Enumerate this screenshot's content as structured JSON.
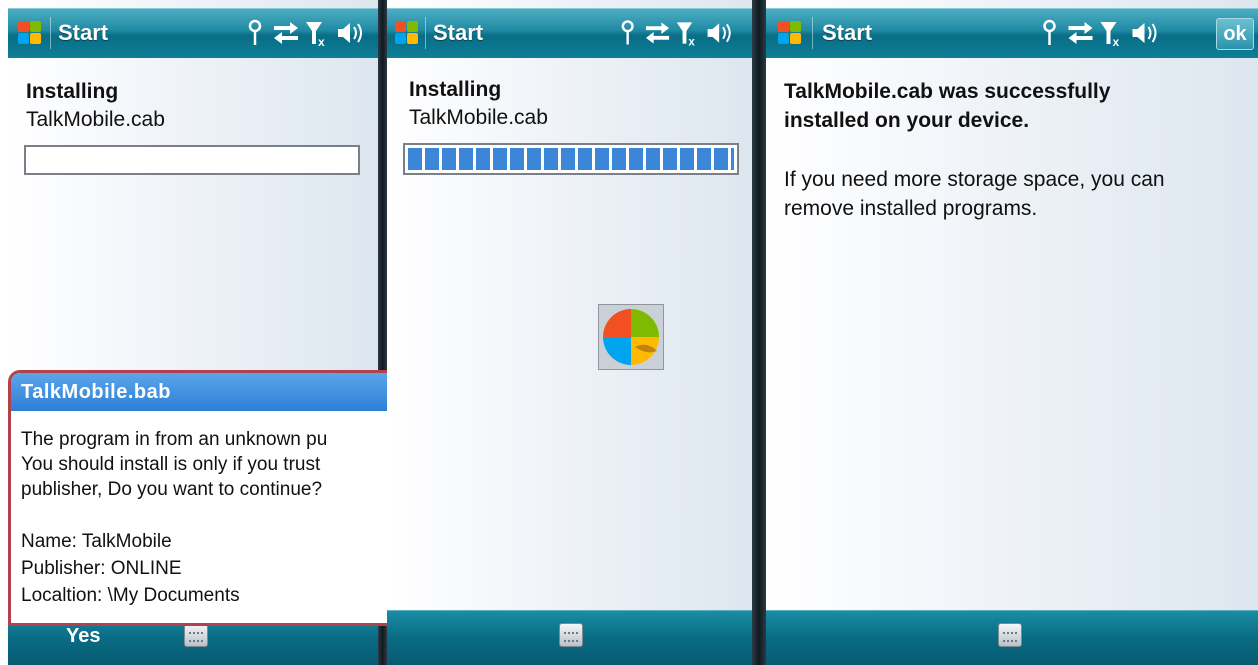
{
  "statusbar": {
    "start_label": "Start",
    "ok_label": "ok"
  },
  "screen1": {
    "heading": "Installing",
    "filename": "TalkMobile.cab",
    "progress": 0,
    "dialog": {
      "title": "TalkMobile.bab",
      "lines": [
        "The program in from an unknown pu",
        "You should install is only if you trust",
        "publisher, Do you want to continue?"
      ],
      "name": "Name: TalkMobile",
      "publisher": "Publisher: ONLINE",
      "location": "Localtion: \\My Documents"
    },
    "softkey_left": "Yes"
  },
  "screen2": {
    "heading": "Installing",
    "filename": "TalkMobile.cab",
    "progress": 1.0
  },
  "screen3": {
    "title_lines": [
      "TalkMobile.cab was successfully",
      "installed on your device."
    ],
    "body_lines": [
      "If you need more storage space, you can",
      "remove installed programs."
    ]
  },
  "icons": [
    "windows-flag-icon",
    "antenna-icon",
    "sync-arrows-icon",
    "signal-off-icon",
    "speaker-icon",
    "keyboard-icon",
    "busy-windows-icon"
  ]
}
